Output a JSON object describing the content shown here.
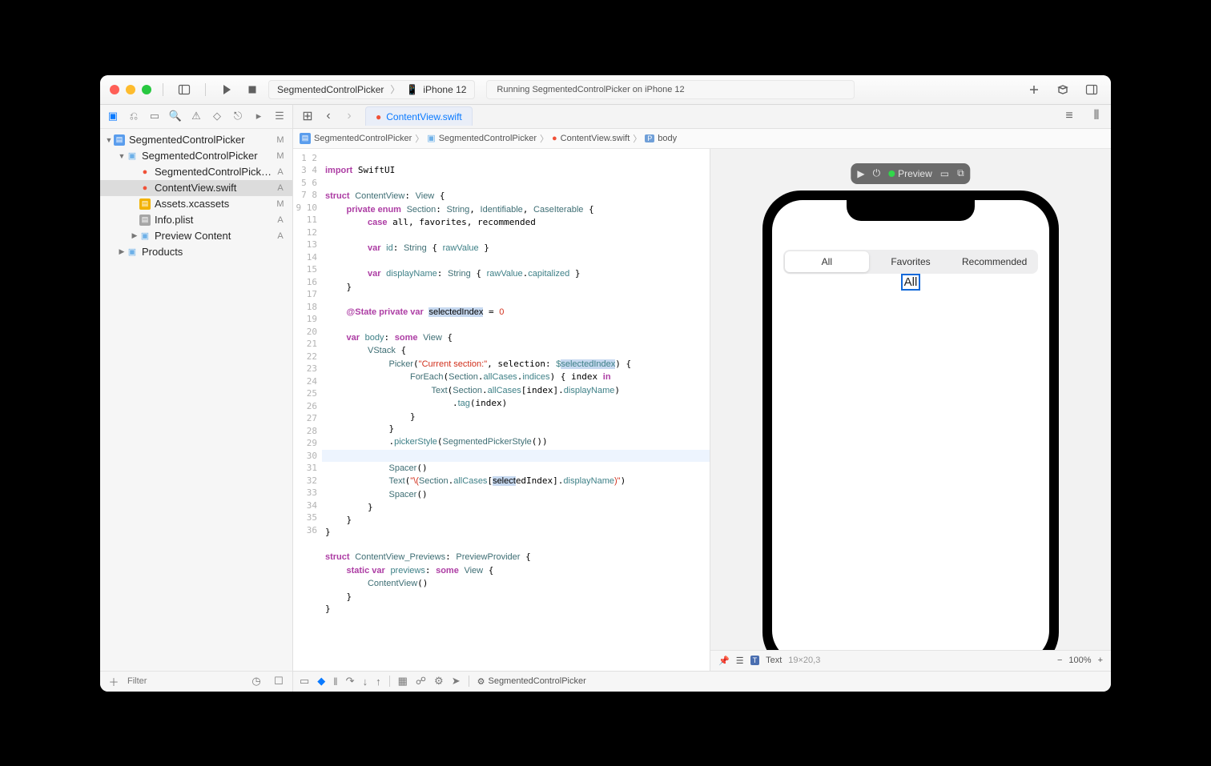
{
  "titlebar": {
    "scheme_project": "SegmentedControlPicker",
    "scheme_device": "iPhone 12",
    "status": "Running SegmentedControlPicker on iPhone 12"
  },
  "navigator": {
    "filter_placeholder": "Filter",
    "tree": [
      {
        "level": 0,
        "icon": "proj",
        "label": "SegmentedControlPicker",
        "badge": "M",
        "disclosure": "▼"
      },
      {
        "level": 1,
        "icon": "folder",
        "label": "SegmentedControlPicker",
        "badge": "M",
        "disclosure": "▼"
      },
      {
        "level": 2,
        "icon": "swift",
        "label": "SegmentedControlPicke...",
        "badge": "A"
      },
      {
        "level": 2,
        "icon": "swift",
        "label": "ContentView.swift",
        "badge": "A",
        "selected": true
      },
      {
        "level": 2,
        "icon": "assets",
        "label": "Assets.xcassets",
        "badge": "M"
      },
      {
        "level": 2,
        "icon": "plist",
        "label": "Info.plist",
        "badge": "A"
      },
      {
        "level": 2,
        "icon": "folder",
        "label": "Preview Content",
        "badge": "A",
        "disclosure": "▶"
      },
      {
        "level": 1,
        "icon": "folder",
        "label": "Products",
        "disclosure": "▶"
      }
    ]
  },
  "tab": {
    "label": "ContentView.swift"
  },
  "jumpbar": {
    "segments": [
      "SegmentedControlPicker",
      "SegmentedControlPicker",
      "ContentView.swift",
      "body"
    ]
  },
  "code": {
    "lines": 36
  },
  "preview": {
    "label": "Preview",
    "segments": [
      "All",
      "Favorites",
      "Recommended"
    ],
    "selected_text": "All",
    "footer_element": "Text",
    "footer_dims": "19×20,3",
    "zoom": "100%"
  },
  "debugbar": {
    "scheme": "SegmentedControlPicker"
  }
}
